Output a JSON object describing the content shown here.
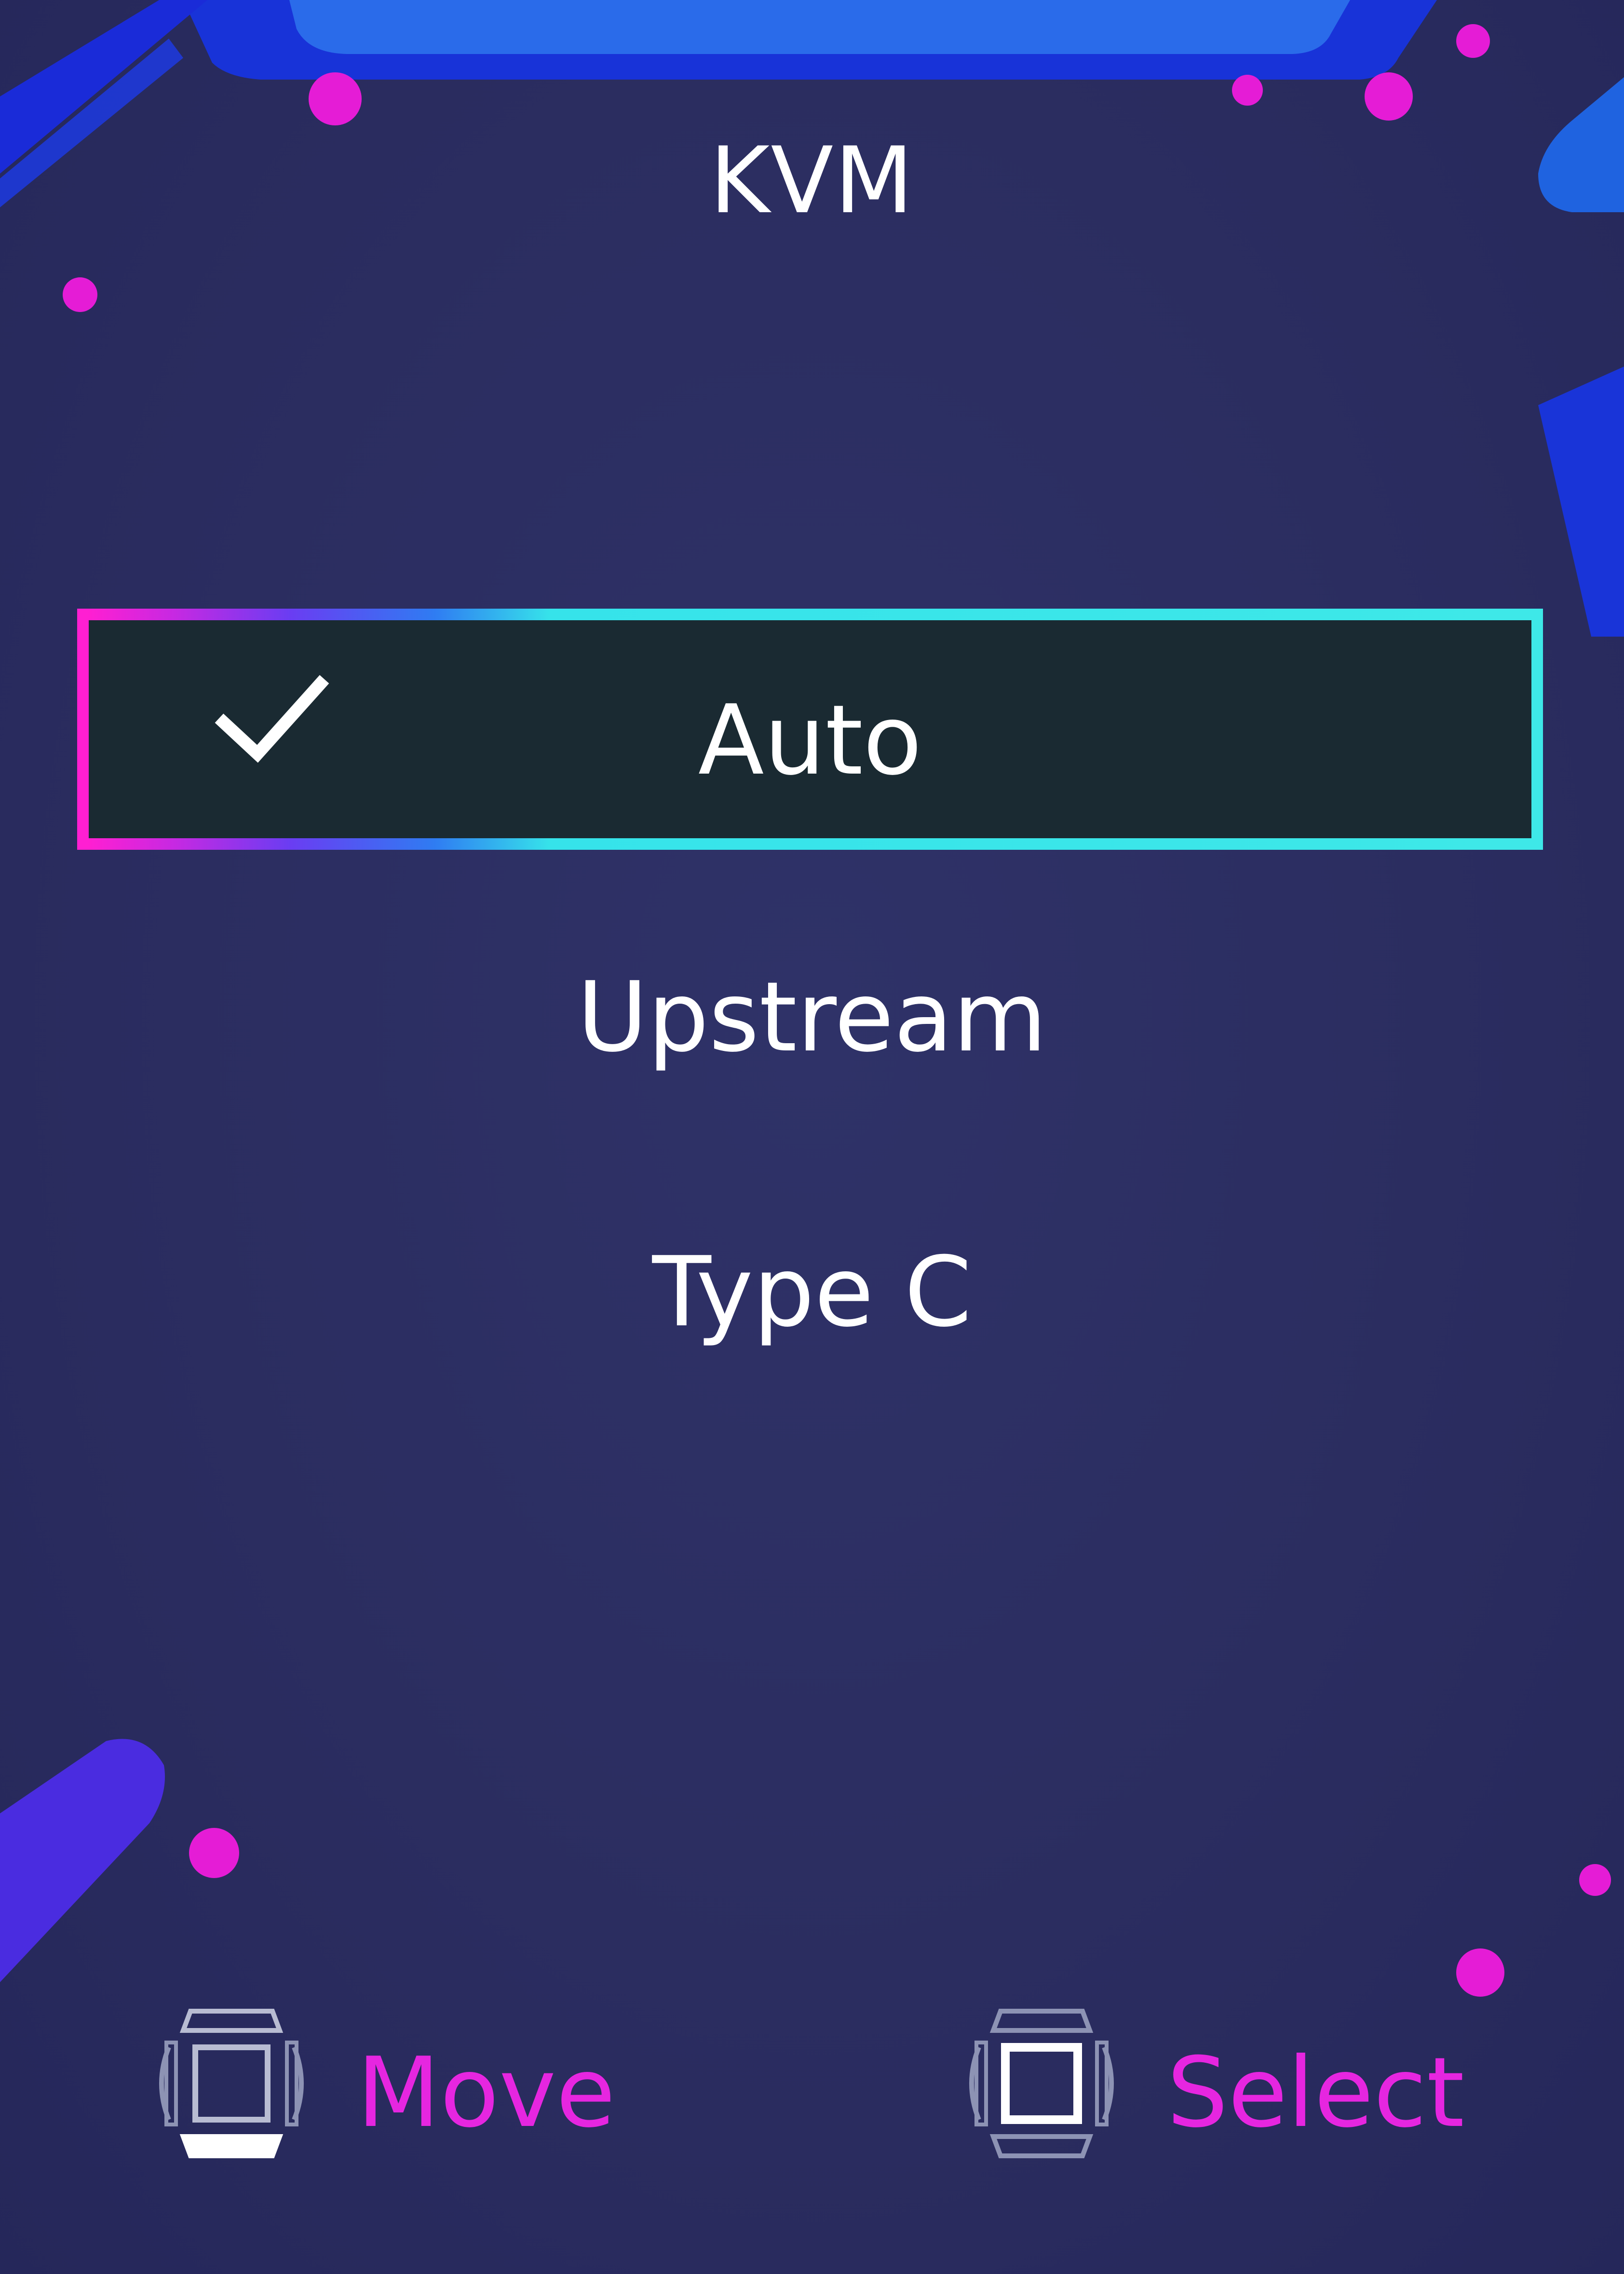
{
  "menu": {
    "title": "KVM",
    "options": [
      {
        "label": "Auto",
        "selected": true,
        "checked": true
      },
      {
        "label": "Upstream",
        "selected": false,
        "checked": false
      },
      {
        "label": "Type C",
        "selected": false,
        "checked": false
      }
    ]
  },
  "footer": {
    "move_label": "Move",
    "select_label": "Select"
  },
  "icons": {
    "check": "check-icon",
    "move": "joystick-move-icon",
    "select": "joystick-select-icon"
  },
  "colors": {
    "background": "#2a2c5e",
    "accent_magenta": "#e51cd6",
    "accent_cyan": "#3ee8e8",
    "accent_blue": "#1a3adf",
    "hint_text": "#e626e0"
  }
}
